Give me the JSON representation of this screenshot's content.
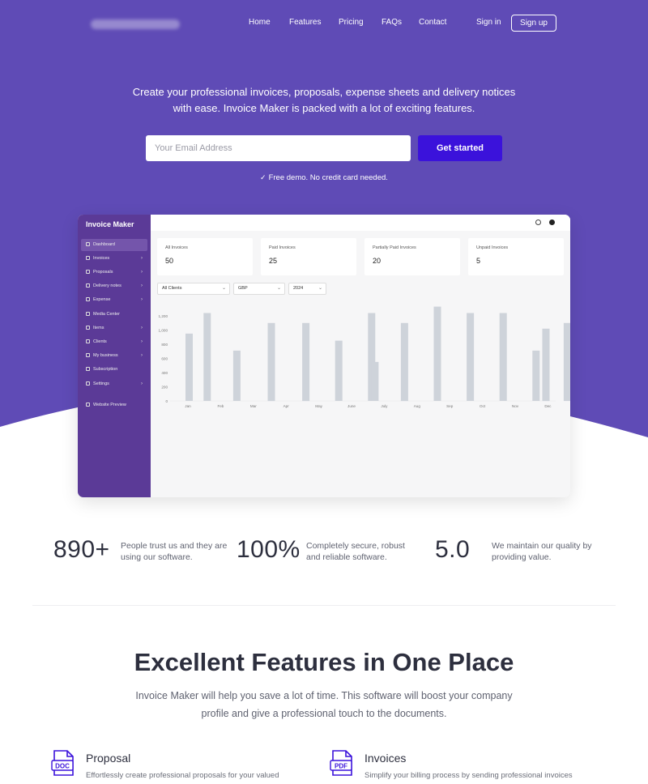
{
  "colors": {
    "hero": "#5f4bb6",
    "accent": "#3b12db",
    "sidebar": "#5b3a97",
    "bars": "#ced3da"
  },
  "nav": {
    "links": [
      "Home",
      "Features",
      "Pricing",
      "FAQs",
      "Contact"
    ],
    "sign_in": "Sign in",
    "sign_up": "Sign up"
  },
  "hero": {
    "line1": "Create your professional invoices, proposals, expense sheets and delivery notices",
    "line2": "with ease. Invoice Maker is packed with a lot of exciting features.",
    "email_placeholder": "Your Email Address",
    "cta": "Get started",
    "note": "Free demo. No credit card needed."
  },
  "dashboard": {
    "app_name": "Invoice Maker",
    "sidebar": [
      {
        "label": "Dashboard",
        "chevron": false,
        "active": true
      },
      {
        "label": "Invoices",
        "chevron": true
      },
      {
        "label": "Proposals",
        "chevron": true
      },
      {
        "label": "Delivery notes",
        "chevron": true
      },
      {
        "label": "Expense",
        "chevron": true
      },
      {
        "label": "Media Center",
        "chevron": false
      },
      {
        "label": "Items",
        "chevron": true
      },
      {
        "label": "Clients",
        "chevron": true
      },
      {
        "label": "My business",
        "chevron": true
      },
      {
        "label": "Subscription",
        "chevron": false
      },
      {
        "label": "Settings",
        "chevron": true
      },
      {
        "label": "Website Preview",
        "chevron": false
      }
    ],
    "cards": [
      {
        "label": "All Invoices",
        "value": "50"
      },
      {
        "label": "Paid Invoices",
        "value": "25"
      },
      {
        "label": "Partially Paid Invoices",
        "value": "20"
      },
      {
        "label": "Unpaid Invoices",
        "value": "5"
      }
    ],
    "filters": [
      "All Clients",
      "GBP",
      "2024"
    ]
  },
  "chart_data": {
    "type": "bar",
    "title": "",
    "xlabel": "",
    "ylabel": "",
    "ylim": [
      0,
      1200
    ],
    "yticks": [
      "0",
      "200",
      "400",
      "600",
      "800",
      "1,000",
      "1,200"
    ],
    "categories": [
      "Jan",
      "Feb",
      "Mar",
      "Apr",
      "May",
      "June",
      "July",
      "Aug",
      "Sep",
      "Oct",
      "Nov",
      "Dec"
    ],
    "series": [
      {
        "values": [
          950,
          1240,
          710,
          1100,
          1100,
          850,
          1240,
          550,
          1100,
          1330,
          1240,
          1240,
          710,
          1020,
          1100,
          950
        ]
      }
    ],
    "bar_slots": [
      0,
      0.55,
      1.45,
      2.5,
      3.55,
      4.55,
      5.55,
      5.65,
      6.55,
      7.55,
      8.55,
      9.55,
      10.55,
      10.85,
      11.5,
      12.05
    ],
    "grid": false,
    "legend": "none"
  },
  "stats": [
    {
      "value": "890+",
      "desc": "People trust us and they are using our software."
    },
    {
      "value": "100%",
      "desc": "Completely secure, robust and reliable software."
    },
    {
      "value": "5.0",
      "desc": "We maintain our quality by providing value."
    }
  ],
  "features": {
    "title": "Excellent Features in One Place",
    "subtitle_line1": "Invoice Maker will help you save a lot of time. This software will boost your company",
    "subtitle_line2": "profile and give a professional touch to the documents.",
    "items": [
      {
        "icon": "doc-file-icon",
        "badge": "DOC",
        "name": "Proposal",
        "desc": "Effortlessly create professional proposals for your valued"
      },
      {
        "icon": "pdf-file-icon",
        "badge": "PDF",
        "name": "Invoices",
        "desc": "Simplify your billing process by sending professional invoices"
      }
    ]
  }
}
